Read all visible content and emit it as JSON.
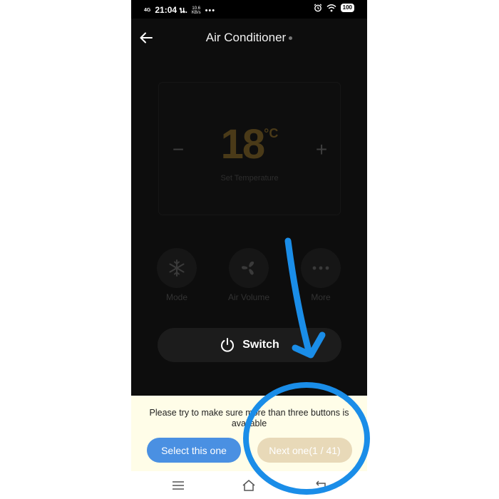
{
  "status_bar": {
    "network": "4G",
    "time": "21:04 น.",
    "speed_value": "10.6",
    "speed_unit": "KB/s",
    "dots": "•••",
    "battery": "100"
  },
  "header": {
    "title": "Air Conditioner"
  },
  "temperature": {
    "minus": "−",
    "value": "18",
    "unit": "°C",
    "plus": "+",
    "label": "Set Temperature"
  },
  "functions": [
    {
      "label": "Mode",
      "icon": "snowflake-icon"
    },
    {
      "label": "Air Volume",
      "icon": "fan-icon"
    },
    {
      "label": "More",
      "icon": "more-dots-icon"
    }
  ],
  "switch": {
    "label": "Switch",
    "icon": "power-icon"
  },
  "prompt": {
    "text": "Please try to make sure more than three buttons is available",
    "select_label": "Select this one",
    "next_label": "Next one(1 / 41)"
  },
  "colors": {
    "accent_blue": "#4a90e2",
    "next_button": "#e8d9b8",
    "annotation": "#1a8de8",
    "background": "#0d0d0d"
  }
}
